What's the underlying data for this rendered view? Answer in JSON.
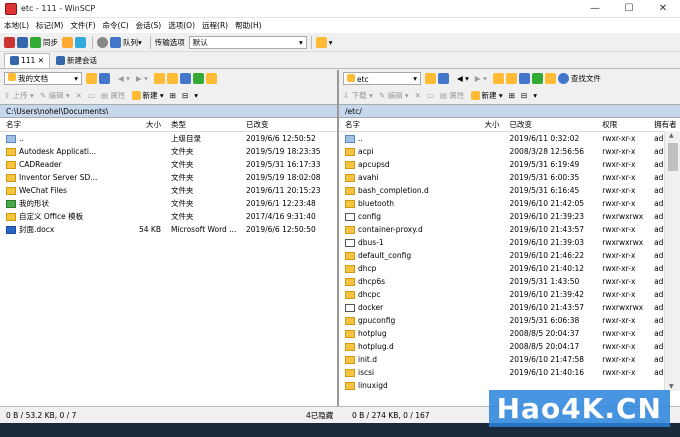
{
  "window": {
    "title": "etc - 111 - WinSCP",
    "controls": [
      "—",
      "☐",
      "✕"
    ]
  },
  "menu": [
    "本地(L)",
    "标记(M)",
    "文件(F)",
    "命令(C)",
    "会话(S)",
    "选项(O)",
    "远程(R)",
    "帮助(H)"
  ],
  "toolbar": {
    "sync": "同步",
    "queue": "队列",
    "transfer_label": "传输选项",
    "transfer_value": "默认"
  },
  "tabs": {
    "session": "111",
    "new_session": "新建会话"
  },
  "left": {
    "location": "我的文档",
    "actions": {
      "upload": "上传",
      "edit": "编辑",
      "props": "属性",
      "new": "新建"
    },
    "path": "C:\\Users\\nohel\\Documents\\",
    "columns": [
      "名字",
      "大小",
      "类型",
      "已改变"
    ],
    "rows": [
      {
        "name": "..",
        "size": "",
        "type": "上级目录",
        "modified": "2019/6/6  12:50:52",
        "icon": "up"
      },
      {
        "name": "Autodesk Applicati...",
        "size": "",
        "type": "文件夹",
        "modified": "2019/5/19  18:23:35",
        "icon": "folder"
      },
      {
        "name": "CADReader",
        "size": "",
        "type": "文件夹",
        "modified": "2019/5/31  16:17:33",
        "icon": "folder"
      },
      {
        "name": "Inventor Server SD...",
        "size": "",
        "type": "文件夹",
        "modified": "2019/5/19  18:02:08",
        "icon": "folder"
      },
      {
        "name": "WeChat Files",
        "size": "",
        "type": "文件夹",
        "modified": "2019/6/11  20:15:23",
        "icon": "folder"
      },
      {
        "name": "我的形状",
        "size": "",
        "type": "文件夹",
        "modified": "2019/6/1  12:23:48",
        "icon": "app"
      },
      {
        "name": "自定义 Office 模板",
        "size": "",
        "type": "文件夹",
        "modified": "2017/4/16  9:31:40",
        "icon": "folder"
      },
      {
        "name": "封面.docx",
        "size": "54 KB",
        "type": "Microsoft Word ...",
        "modified": "2019/6/6  12:50:50",
        "icon": "doc"
      }
    ],
    "status": "0 B / 53.2 KB,   0 / 7",
    "hidden": "4已隐藏"
  },
  "right": {
    "location": "etc",
    "actions": {
      "download": "下载",
      "edit": "编辑",
      "props": "属性",
      "new": "新建",
      "find": "查找文件"
    },
    "path": "/etc/",
    "columns": [
      "名字",
      "大小",
      "已改变",
      "权限",
      "拥有者"
    ],
    "rows": [
      {
        "name": "..",
        "size": "",
        "modified": "2019/6/11  0:32:02",
        "perm": "rwxr-xr-x",
        "owner": "admin",
        "icon": "up"
      },
      {
        "name": "acpi",
        "size": "",
        "modified": "2008/3/28  12:56:56",
        "perm": "rwxr-xr-x",
        "owner": "admin",
        "icon": "folder"
      },
      {
        "name": "apcupsd",
        "size": "",
        "modified": "2019/5/31  6:19:49",
        "perm": "rwxr-xr-x",
        "owner": "admin",
        "icon": "folder"
      },
      {
        "name": "avahi",
        "size": "",
        "modified": "2019/5/31  6:00:35",
        "perm": "rwxr-xr-x",
        "owner": "admin",
        "icon": "folder"
      },
      {
        "name": "bash_completion.d",
        "size": "",
        "modified": "2019/5/31  6:16:45",
        "perm": "rwxr-xr-x",
        "owner": "admin",
        "icon": "folder"
      },
      {
        "name": "bluetooth",
        "size": "",
        "modified": "2019/6/10  21:42:05",
        "perm": "rwxr-xr-x",
        "owner": "admin",
        "icon": "folder"
      },
      {
        "name": "config",
        "size": "",
        "modified": "2019/6/10  21:39:23",
        "perm": "rwxrwxrwx",
        "owner": "admin",
        "icon": "lnk"
      },
      {
        "name": "container-proxy.d",
        "size": "",
        "modified": "2019/6/10  21:43:57",
        "perm": "rwxr-xr-x",
        "owner": "admin",
        "icon": "folder"
      },
      {
        "name": "dbus-1",
        "size": "",
        "modified": "2019/6/10  21:39:03",
        "perm": "rwxrwxrwx",
        "owner": "admin",
        "icon": "lnk"
      },
      {
        "name": "default_config",
        "size": "",
        "modified": "2019/6/10  21:46:22",
        "perm": "rwxr-xr-x",
        "owner": "admin",
        "icon": "folder"
      },
      {
        "name": "dhcp",
        "size": "",
        "modified": "2019/6/10  21:40:12",
        "perm": "rwxr-xr-x",
        "owner": "admin",
        "icon": "folder"
      },
      {
        "name": "dhcp6s",
        "size": "",
        "modified": "2019/5/31  1:43:50",
        "perm": "rwxr-xr-x",
        "owner": "admin",
        "icon": "folder"
      },
      {
        "name": "dhcpc",
        "size": "",
        "modified": "2019/6/10  21:39:42",
        "perm": "rwxr-xr-x",
        "owner": "admin",
        "icon": "folder"
      },
      {
        "name": "docker",
        "size": "",
        "modified": "2019/6/10  21:43:57",
        "perm": "rwxrwxrwx",
        "owner": "admin",
        "icon": "lnk"
      },
      {
        "name": "gpuconfig",
        "size": "",
        "modified": "2019/5/31  6:06:38",
        "perm": "rwxr-xr-x",
        "owner": "admin",
        "icon": "folder"
      },
      {
        "name": "hotplug",
        "size": "",
        "modified": "2008/8/5  20:04:37",
        "perm": "rwxr-xr-x",
        "owner": "admin",
        "icon": "folder"
      },
      {
        "name": "hotplug.d",
        "size": "",
        "modified": "2008/8/5  20:04:17",
        "perm": "rwxr-xr-x",
        "owner": "admin",
        "icon": "folder"
      },
      {
        "name": "init.d",
        "size": "",
        "modified": "2019/6/10  21:47:58",
        "perm": "rwxr-xr-x",
        "owner": "admin",
        "icon": "folder"
      },
      {
        "name": "iscsi",
        "size": "",
        "modified": "2019/6/10  21:40:16",
        "perm": "rwxr-xr-x",
        "owner": "admin",
        "icon": "folder"
      },
      {
        "name": "linuxigd",
        "size": "",
        "modified": "",
        "perm": "",
        "owner": "",
        "icon": "folder"
      }
    ],
    "status": "0 B / 274 KB,   0 / 167"
  },
  "watermark": "Hao4K.CN"
}
